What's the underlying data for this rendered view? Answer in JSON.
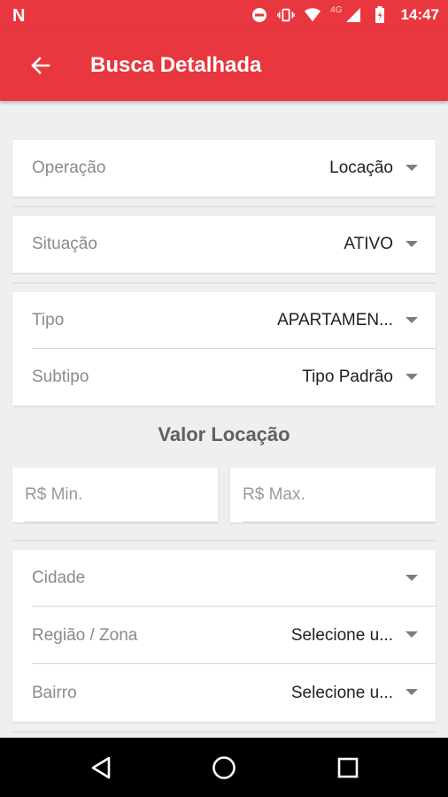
{
  "status_bar": {
    "carrier_icon": "N",
    "network": "4G",
    "time": "14:47",
    "icons": [
      "dnd-icon",
      "vibrate-icon",
      "wifi-icon",
      "signal-icon",
      "battery-icon"
    ]
  },
  "app_bar": {
    "title": "Busca Detalhada",
    "back_icon": "arrow-back-icon",
    "color": "#e8373e"
  },
  "operacao": {
    "label": "Operação",
    "value": "Locação"
  },
  "situacao": {
    "label": "Situação",
    "value": "ATIVO"
  },
  "tipo": {
    "label": "Tipo",
    "value": "APARTAMEN..."
  },
  "subtipo": {
    "label": "Subtipo",
    "value": "Tipo Padrão"
  },
  "valor_locacao": {
    "title": "Valor Locação",
    "min_placeholder": "R$ Min.",
    "max_placeholder": "R$ Max."
  },
  "cidade": {
    "label": "Cidade",
    "value": ""
  },
  "regiao": {
    "label": "Região / Zona",
    "value": "Selecione u..."
  },
  "bairro": {
    "label": "Bairro",
    "value": "Selecione u..."
  },
  "nav_bar": {
    "buttons": [
      "back-triangle-icon",
      "home-circle-icon",
      "recents-square-icon"
    ]
  }
}
